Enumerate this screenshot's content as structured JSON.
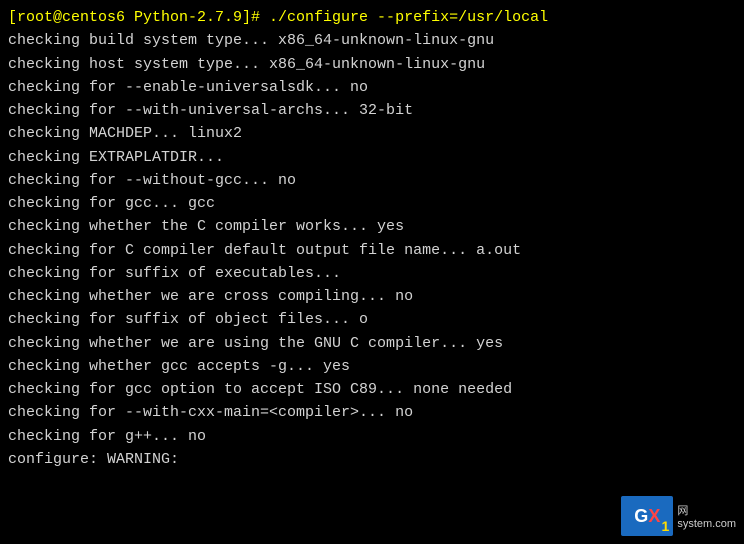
{
  "terminal": {
    "lines": [
      {
        "id": "line1",
        "text": "[root@centos6 Python-2.7.9]# ./configure --prefix=/usr/local",
        "class": "text-yellow"
      },
      {
        "id": "line2",
        "text": "checking build system type... x86_64-unknown-linux-gnu",
        "class": ""
      },
      {
        "id": "line3",
        "text": "checking host system type... x86_64-unknown-linux-gnu",
        "class": ""
      },
      {
        "id": "line4",
        "text": "checking for --enable-universalsdk... no",
        "class": ""
      },
      {
        "id": "line5",
        "text": "checking for --with-universal-archs... 32-bit",
        "class": ""
      },
      {
        "id": "line6",
        "text": "checking MACHDEP... linux2",
        "class": ""
      },
      {
        "id": "line7",
        "text": "checking EXTRAPLATDIR...",
        "class": ""
      },
      {
        "id": "line8",
        "text": "checking for --without-gcc... no",
        "class": ""
      },
      {
        "id": "line9",
        "text": "checking for gcc... gcc",
        "class": ""
      },
      {
        "id": "line10",
        "text": "checking whether the C compiler works... yes",
        "class": ""
      },
      {
        "id": "line11",
        "text": "checking for C compiler default output file name... a.out",
        "class": ""
      },
      {
        "id": "line12",
        "text": "checking for suffix of executables...",
        "class": ""
      },
      {
        "id": "line13",
        "text": "checking whether we are cross compiling... no",
        "class": ""
      },
      {
        "id": "line14",
        "text": "checking for suffix of object files... o",
        "class": ""
      },
      {
        "id": "line15",
        "text": "checking whether we are using the GNU C compiler... yes",
        "class": ""
      },
      {
        "id": "line16",
        "text": "checking whether gcc accepts -g... yes",
        "class": ""
      },
      {
        "id": "line17",
        "text": "checking for gcc option to accept ISO C89... none needed",
        "class": ""
      },
      {
        "id": "line18",
        "text": "checking for --with-cxx-main=<compiler>... no",
        "class": ""
      },
      {
        "id": "line19",
        "text": "checking for g++... no",
        "class": ""
      },
      {
        "id": "line20",
        "text": "configure: WARNING:",
        "class": ""
      }
    ]
  },
  "watermark": {
    "logo_g": "G",
    "logo_x": "X",
    "logo_1": "1",
    "site_top": "网",
    "site_bottom": "system.com"
  }
}
